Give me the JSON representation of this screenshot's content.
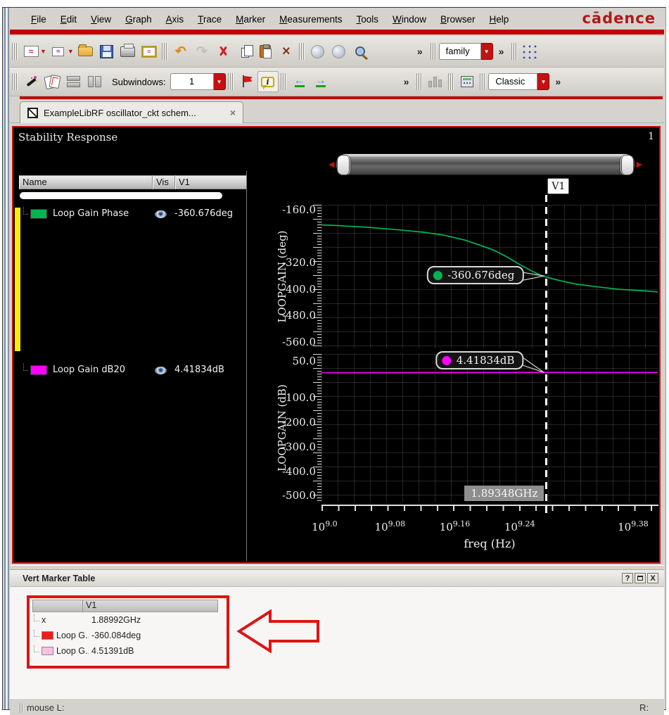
{
  "window": {
    "logo": "cādence"
  },
  "menubar": {
    "items": [
      "File",
      "Edit",
      "View",
      "Graph",
      "Axis",
      "Trace",
      "Marker",
      "Measurements",
      "Tools",
      "Window",
      "Browser",
      "Help"
    ]
  },
  "toolbar": {
    "subwindows_label": "Subwindows:",
    "subwindows_value": "1",
    "family_value": "family",
    "classic_value": "Classic",
    "overflow": "»",
    "dropdown_glyph": "▼",
    "undo_glyph": "↶",
    "redo_glyph": "↷",
    "prev_glyph": "←",
    "next_glyph": "→",
    "slider_left_glyph": "◀",
    "slider_right_glyph": "▶"
  },
  "tabbar": {
    "tab_label": "ExampleLibRF oscillator_ckt schem...",
    "close": "×"
  },
  "graph": {
    "page_number": "1",
    "columns": {
      "name": "Name",
      "vis": "Vis",
      "v1": "V1"
    },
    "signals": [
      {
        "name": "Loop Gain Phase",
        "color": "#00b551",
        "value": "-360.676deg"
      },
      {
        "name": "Loop Gain dB20",
        "color": "#ff00ff",
        "value": "4.41834dB"
      }
    ]
  },
  "chart_data": {
    "type": "line",
    "title": "Stability Response",
    "xlabel": "freq (Hz)",
    "xscale": "log10",
    "xlim_log": [
      9.0,
      9.415
    ],
    "grid": true,
    "xticks": [
      {
        "log": 9.0,
        "exp": "9.0"
      },
      {
        "log": 9.08,
        "exp": "9.08"
      },
      {
        "log": 9.16,
        "exp": "9.16"
      },
      {
        "log": 9.24,
        "exp": "9.24"
      },
      {
        "log": 9.38,
        "exp": "9.38"
      }
    ],
    "subplots": [
      {
        "ylabel": "LOOPGAIN (deg)",
        "ylim": [
          -580,
          -145
        ],
        "yticks": [
          -160,
          -320,
          -400,
          -480,
          -560
        ],
        "series": [
          {
            "name": "Loop Gain Phase",
            "color": "#00b551",
            "points": [
              [
                9.0,
                -206
              ],
              [
                9.013,
                -207
              ],
              [
                9.056,
                -213
              ],
              [
                9.091,
                -220
              ],
              [
                9.125,
                -228
              ],
              [
                9.151,
                -237
              ],
              [
                9.177,
                -252
              ],
              [
                9.195,
                -267
              ],
              [
                9.212,
                -282
              ],
              [
                9.229,
                -303
              ],
              [
                9.246,
                -328
              ],
              [
                9.259,
                -345
              ],
              [
                9.272,
                -360
              ],
              [
                9.285,
                -369
              ],
              [
                9.298,
                -377
              ],
              [
                9.316,
                -386
              ],
              [
                9.342,
                -394
              ],
              [
                9.367,
                -401
              ],
              [
                9.393,
                -405
              ],
              [
                9.415,
                -409
              ]
            ]
          }
        ]
      },
      {
        "ylabel": "LOOPGAIN (dB)",
        "ylim": [
          -525,
          80
        ],
        "yticks": [
          50,
          -100,
          -200,
          -300,
          -400,
          -500
        ],
        "series": [
          {
            "name": "Loop Gain dB20",
            "color": "#ff00ff",
            "points": [
              [
                9.0,
                3.2
              ],
              [
                9.05,
                3.3
              ],
              [
                9.09,
                3.5
              ],
              [
                9.13,
                3.7
              ],
              [
                9.16,
                3.9
              ],
              [
                9.2,
                4.1
              ],
              [
                9.23,
                4.25
              ],
              [
                9.2773,
                4.42
              ],
              [
                9.31,
                4.35
              ],
              [
                9.34,
                4.3
              ],
              [
                9.38,
                4.25
              ],
              [
                9.415,
                4.2
              ]
            ]
          }
        ]
      }
    ],
    "marker": {
      "name": "V1",
      "freq_label": "1.89348GHz",
      "freq_log": 9.2773,
      "values": [
        {
          "series": "Loop Gain Phase",
          "label": "-360.676deg",
          "y": -360.676,
          "subplot": 0,
          "color": "#00b551"
        },
        {
          "series": "Loop Gain dB20",
          "label": "4.41834dB",
          "y": 4.41834,
          "subplot": 1,
          "color": "#ff00ff"
        }
      ]
    }
  },
  "vert_marker_table": {
    "title": "Vert Marker Table",
    "help_button": "?",
    "close_button": "X",
    "column": "V1",
    "rows": [
      {
        "label": "x",
        "value": "1.88992GHz"
      },
      {
        "swatch": "#ee1c1c",
        "label": "Loop G...",
        "value": "-360.084deg"
      },
      {
        "swatch": "#f9c0e4",
        "label": "Loop G...",
        "value": "4.51391dB"
      }
    ]
  },
  "statusbar": {
    "left": "mouse L:",
    "right": "R:"
  },
  "colors": {
    "accent_red": "#c40000",
    "strip_yellow": "#ffee00"
  }
}
